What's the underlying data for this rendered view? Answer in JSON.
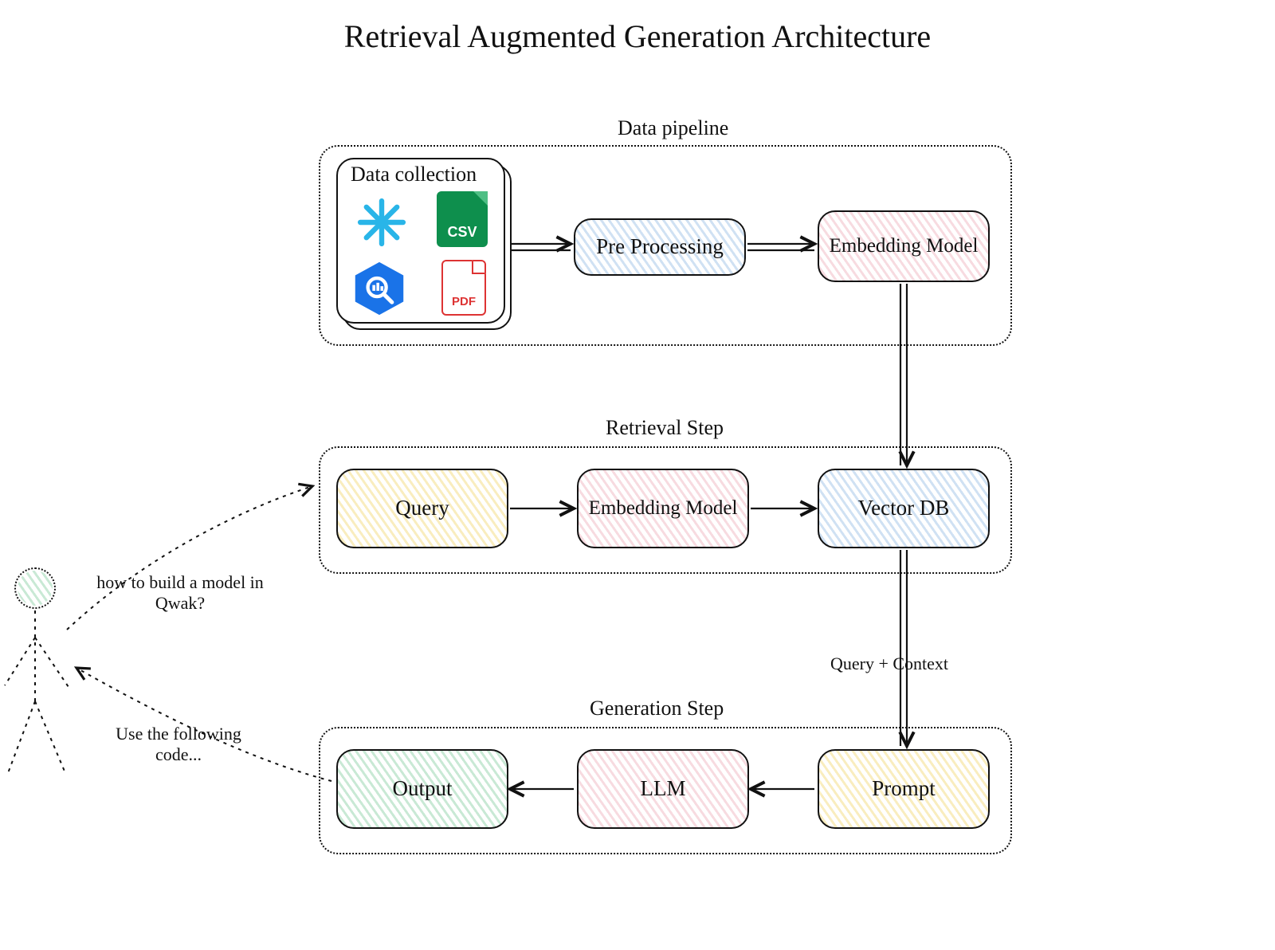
{
  "title": "Retrieval Augmented Generation Architecture",
  "sections": {
    "data_pipeline": {
      "label": "Data pipeline"
    },
    "retrieval_step": {
      "label": "Retrieval Step"
    },
    "generation_step": {
      "label": "Generation Step"
    }
  },
  "data_collection": {
    "title": "Data collection",
    "icons": {
      "snowflake": "snowflake-icon",
      "csv_label": "CSV",
      "bigquery": "bigquery-icon",
      "pdf_label": "PDF"
    }
  },
  "nodes": {
    "pre_processing": "Pre Processing",
    "embedding_model_1": "Embedding Model",
    "query": "Query",
    "embedding_model_2": "Embedding Model",
    "vector_db": "Vector DB",
    "prompt": "Prompt",
    "llm": "LLM",
    "output": "Output"
  },
  "annotations": {
    "user_question": "how to build a model in Qwak?",
    "assistant_answer": "Use the following code...",
    "query_plus_context": "Query + Context"
  },
  "flow": {
    "edges_double": [
      [
        "data_collection",
        "pre_processing"
      ],
      [
        "pre_processing",
        "embedding_model_1"
      ]
    ],
    "edges_single": [
      [
        "embedding_model_1",
        "vector_db"
      ],
      [
        "query",
        "embedding_model_2"
      ],
      [
        "embedding_model_2",
        "vector_db"
      ],
      [
        "vector_db",
        "prompt",
        "label:query_plus_context"
      ],
      [
        "prompt",
        "llm"
      ],
      [
        "llm",
        "output"
      ]
    ],
    "edges_dotted": [
      [
        "user",
        "query",
        "label:user_question"
      ],
      [
        "output",
        "user",
        "label:assistant_answer"
      ]
    ]
  },
  "colors": {
    "blue": "#7aa9d6",
    "pink": "#e9a4b0",
    "yellow": "#efd060",
    "green": "#7fc897",
    "csv": "#0e8f4d",
    "pdf": "#d33",
    "bigquery": "#1a73e8",
    "snowflake": "#29b5e8"
  }
}
